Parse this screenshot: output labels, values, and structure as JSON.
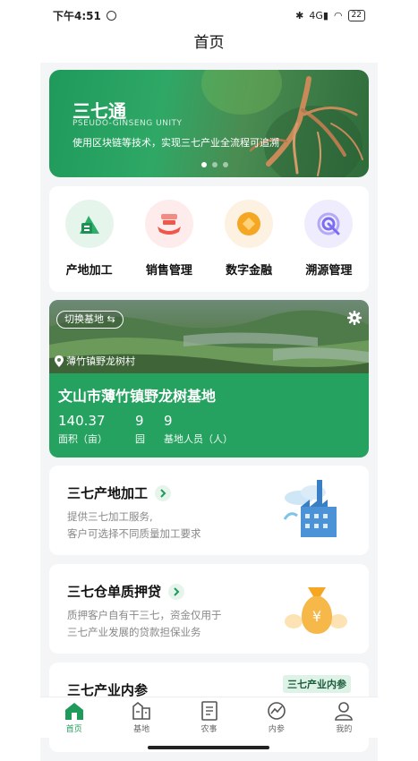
{
  "status_bar": {
    "time": "下午4:51",
    "signal": "4G",
    "battery": "22"
  },
  "header": {
    "title": "首页"
  },
  "banner": {
    "title": "三七通",
    "subtitle": "PSEUDO-GINSENG UNITY",
    "description": "使用区块链等技术，实现三七产业全流程可追溯"
  },
  "menu": [
    {
      "label": "产地加工",
      "icon": "processing-icon",
      "color": "#2fae6a"
    },
    {
      "label": "销售管理",
      "icon": "sales-icon",
      "color": "#f0574a"
    },
    {
      "label": "数字金融",
      "icon": "coin-icon",
      "color": "#f5a623"
    },
    {
      "label": "溯源管理",
      "icon": "trace-icon",
      "color": "#7b6cf0"
    }
  ],
  "base": {
    "switch_label": "切换基地 ⇆",
    "village": "薄竹镇野龙树村",
    "name": "文山市薄竹镇野龙树基地",
    "stats": [
      {
        "value": "140.37",
        "label": "面积（亩）"
      },
      {
        "value": "9",
        "label": "园"
      },
      {
        "value": "9",
        "label": "基地人员（人）"
      }
    ]
  },
  "cards": [
    {
      "title": "三七产地加工",
      "desc_line1": "提供三七加工服务,",
      "desc_line2": "客户可选择不同质量加工要求"
    },
    {
      "title": "三七仓单质押贷",
      "desc_line1": "质押客户自有干三七，资金仅用于",
      "desc_line2": "三七产业发展的贷款担保业务"
    },
    {
      "title": "三七产业内参",
      "tag": "三七产业内参"
    }
  ],
  "tabs": [
    {
      "label": "首页",
      "icon": "home-icon",
      "active": true
    },
    {
      "label": "基地",
      "icon": "base-icon",
      "active": false
    },
    {
      "label": "农事",
      "icon": "farm-icon",
      "active": false
    },
    {
      "label": "内参",
      "icon": "chart-icon",
      "active": false
    },
    {
      "label": "我的",
      "icon": "user-icon",
      "active": false
    }
  ],
  "colors": {
    "brand": "#1f9a5b",
    "background": "#f4f5f7"
  }
}
